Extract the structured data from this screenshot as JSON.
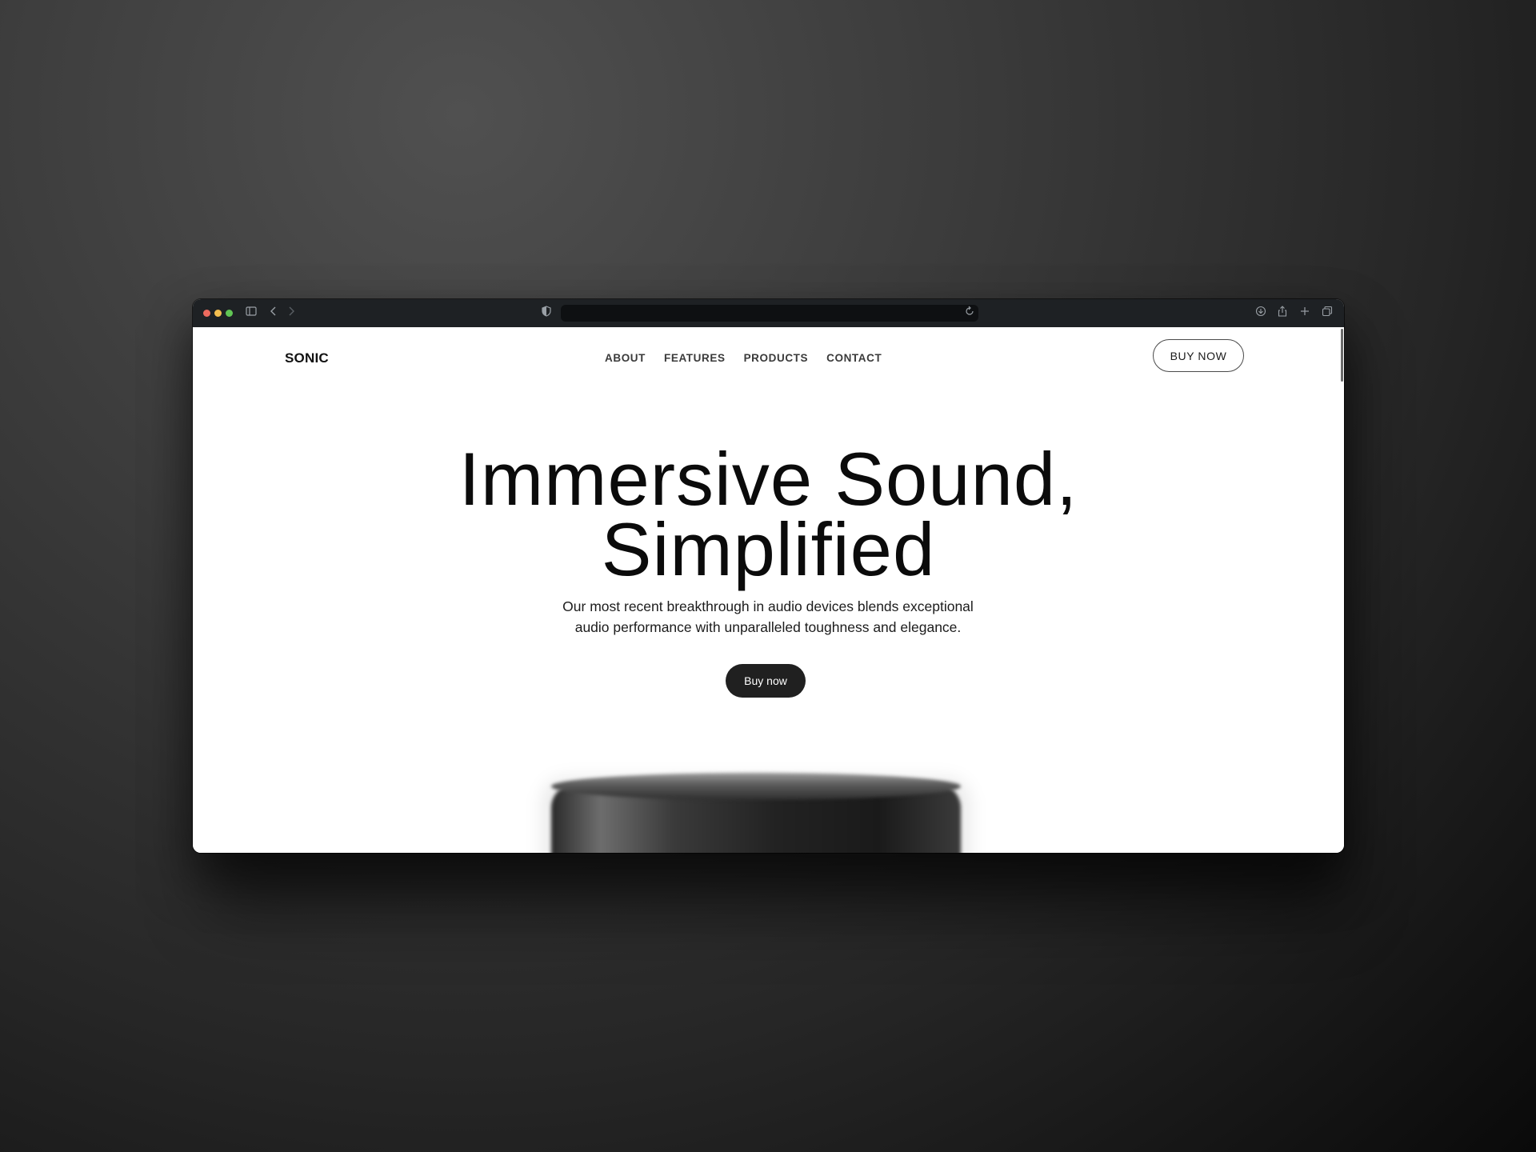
{
  "browser": {
    "icons": [
      "sidebar-icon",
      "back-icon",
      "forward-icon",
      "shield-icon",
      "reload-icon",
      "download-icon",
      "share-icon",
      "plus-icon",
      "tabs-icon"
    ],
    "url": ""
  },
  "site": {
    "logo": "SONIC",
    "nav": [
      "ABOUT",
      "FEATURES",
      "PRODUCTS",
      "CONTACT"
    ],
    "header_cta": "BUY NOW"
  },
  "hero": {
    "title_line1": "Immersive Sound,",
    "title_line2": "Simplified",
    "subtitle_line1": "Our most recent breakthrough in audio devices blends exceptional",
    "subtitle_line2": "audio performance with unparalleled toughness and elegance.",
    "cta": "Buy now"
  },
  "colors": {
    "accent": "#202020",
    "chrome": "#1e2124",
    "background": "#ffffff"
  }
}
